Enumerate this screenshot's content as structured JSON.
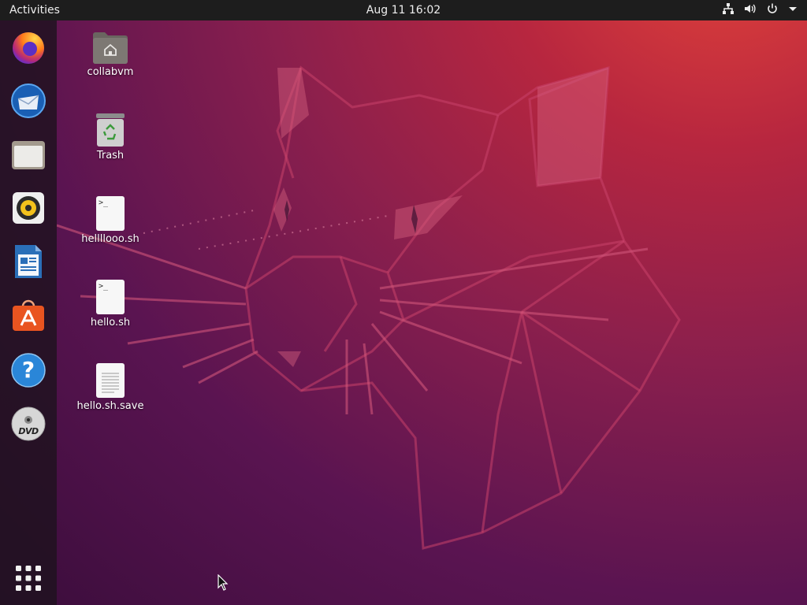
{
  "topbar": {
    "activities_label": "Activities",
    "clock_label": "Aug 11  16:02",
    "tray_icons": [
      "network-icon",
      "volume-icon",
      "power-icon",
      "dropdown-icon"
    ]
  },
  "dock": {
    "items": [
      {
        "name": "Firefox",
        "icon": "firefox-icon"
      },
      {
        "name": "Thunderbird",
        "icon": "thunderbird-icon"
      },
      {
        "name": "Files",
        "icon": "files-icon"
      },
      {
        "name": "Rhythmbox",
        "icon": "rhythmbox-icon"
      },
      {
        "name": "LibreOffice Writer",
        "icon": "writer-icon"
      },
      {
        "name": "Ubuntu Software",
        "icon": "software-icon"
      },
      {
        "name": "Help",
        "icon": "help-icon"
      },
      {
        "name": "DVD",
        "icon": "dvd-icon"
      }
    ],
    "show_apps_icon": "app-grid-icon",
    "help_glyph": "?",
    "dvd_glyph": "DVD"
  },
  "desktop": {
    "items": [
      {
        "label": "collabvm",
        "icon": "home-folder-icon"
      },
      {
        "label": "Trash",
        "icon": "trash-icon"
      },
      {
        "label": "hellllooo.sh",
        "icon": "script-file-icon"
      },
      {
        "label": "hello.sh",
        "icon": "script-file-icon"
      },
      {
        "label": "hello.sh.save",
        "icon": "text-file-icon"
      }
    ],
    "script_glyph": ">_"
  },
  "colors": {
    "topbar": "#1d1d1d",
    "dock": "#1e121e",
    "wallpaper_top": "#e2433a",
    "wallpaper_bottom": "#3a0d3b",
    "ubuntu_orange": "#e95420"
  }
}
